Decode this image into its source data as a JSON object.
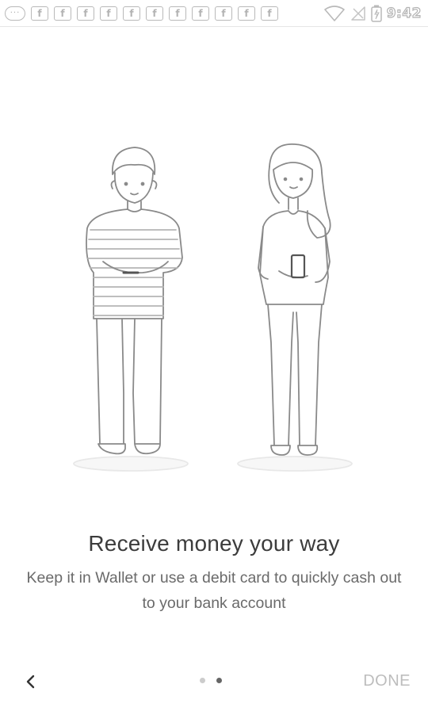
{
  "status_bar": {
    "time": "9:42",
    "notification_icons": [
      "messenger-icon",
      "facebook-icon",
      "facebook-icon",
      "facebook-icon",
      "facebook-icon",
      "facebook-icon",
      "facebook-icon",
      "facebook-icon",
      "facebook-icon",
      "facebook-icon",
      "facebook-icon",
      "facebook-icon"
    ],
    "notification_glyph": "f",
    "messenger_glyph": "···",
    "right_icons": [
      "wifi-icon",
      "no-signal-icon",
      "battery-icon"
    ]
  },
  "onboarding": {
    "title": "Receive money your way",
    "description": "Keep it in Wallet or use a debit card to quickly cash out to your bank account",
    "page_count": 2,
    "current_page": 2
  },
  "nav": {
    "back_icon": "chevron-left-icon",
    "done_label": "DONE"
  },
  "colors": {
    "background": "#ffffff",
    "title": "#3c3c3c",
    "body": "#6a6a6a",
    "done_disabled": "#bdbdbd",
    "dot_active": "#666666",
    "dot_inactive": "#cccccc"
  }
}
